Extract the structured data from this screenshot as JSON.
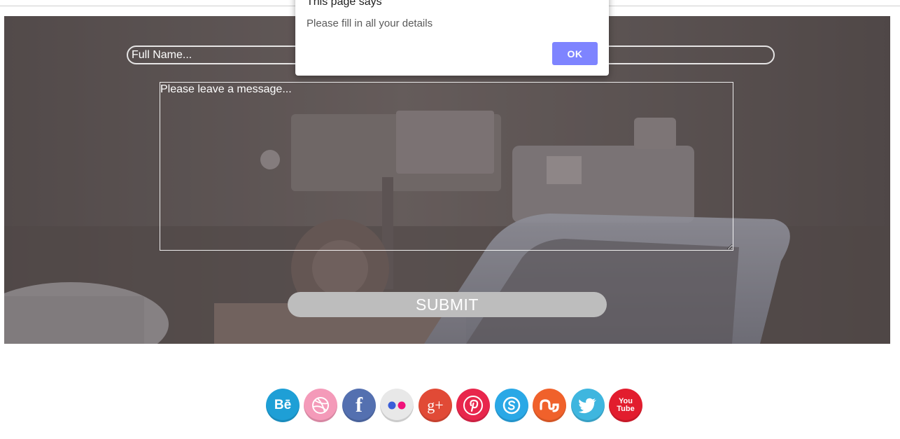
{
  "form": {
    "name_placeholder": "Full Name...",
    "message_placeholder": "Please leave a message...",
    "submit_label": "SUBMIT"
  },
  "dialog": {
    "title": "This page says",
    "message": "Please fill in all your details",
    "ok_label": "OK",
    "accent_color": "#7e84ff"
  },
  "social": [
    {
      "name": "behance-icon",
      "glyph": "Bē",
      "color": "#1e9fd6"
    },
    {
      "name": "dribbble-icon",
      "glyph": "",
      "color": "#f49ab9"
    },
    {
      "name": "facebook-icon",
      "glyph": "f",
      "color": "#5470b0"
    },
    {
      "name": "flickr-icon",
      "glyph": "",
      "color": "#e8e8e8"
    },
    {
      "name": "google-plus-icon",
      "glyph": "g+",
      "color": "#e14a36"
    },
    {
      "name": "pinterest-icon",
      "glyph": "",
      "color": "#e8264c"
    },
    {
      "name": "skype-icon",
      "glyph": "",
      "color": "#2aa8e6"
    },
    {
      "name": "stumbleupon-icon",
      "glyph": "",
      "color": "#f0612b"
    },
    {
      "name": "twitter-icon",
      "glyph": "",
      "color": "#3fb6df"
    },
    {
      "name": "youtube-icon",
      "glyph": "You Tube",
      "color": "#e21d2e"
    }
  ]
}
